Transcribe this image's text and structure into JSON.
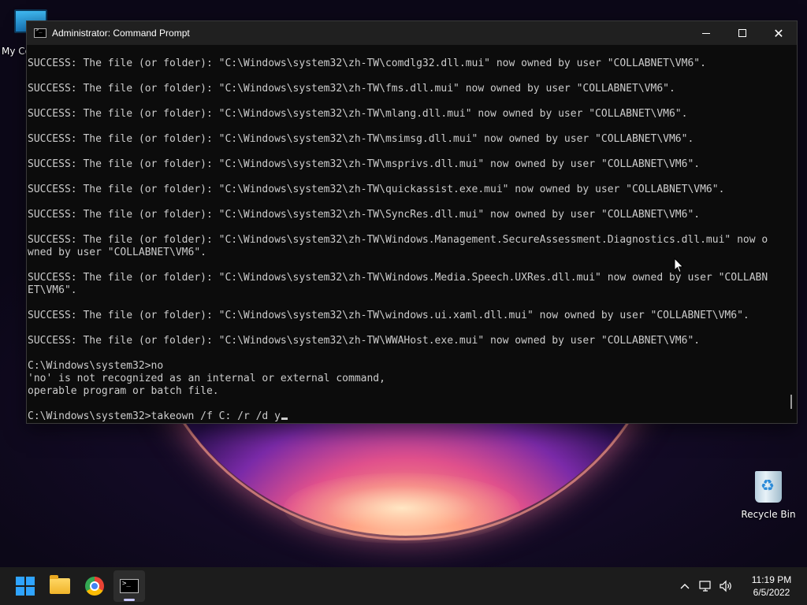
{
  "desktop": {
    "icons": [
      {
        "label": "My Co"
      },
      {
        "label": "Recycle Bin"
      }
    ]
  },
  "window": {
    "title": "Administrator: Command Prompt",
    "controls": {
      "minimize": "",
      "maximize": "",
      "close": "✕"
    }
  },
  "console": {
    "lines": [
      "SUCCESS: The file (or folder): \"C:\\Windows\\system32\\zh-TW\\comdlg32.dll.mui\" now owned by user \"COLLABNET\\VM6\".",
      "",
      "SUCCESS: The file (or folder): \"C:\\Windows\\system32\\zh-TW\\fms.dll.mui\" now owned by user \"COLLABNET\\VM6\".",
      "",
      "SUCCESS: The file (or folder): \"C:\\Windows\\system32\\zh-TW\\mlang.dll.mui\" now owned by user \"COLLABNET\\VM6\".",
      "",
      "SUCCESS: The file (or folder): \"C:\\Windows\\system32\\zh-TW\\msimsg.dll.mui\" now owned by user \"COLLABNET\\VM6\".",
      "",
      "SUCCESS: The file (or folder): \"C:\\Windows\\system32\\zh-TW\\msprivs.dll.mui\" now owned by user \"COLLABNET\\VM6\".",
      "",
      "SUCCESS: The file (or folder): \"C:\\Windows\\system32\\zh-TW\\quickassist.exe.mui\" now owned by user \"COLLABNET\\VM6\".",
      "",
      "SUCCESS: The file (or folder): \"C:\\Windows\\system32\\zh-TW\\SyncRes.dll.mui\" now owned by user \"COLLABNET\\VM6\".",
      "",
      "SUCCESS: The file (or folder): \"C:\\Windows\\system32\\zh-TW\\Windows.Management.SecureAssessment.Diagnostics.dll.mui\" now o",
      "wned by user \"COLLABNET\\VM6\".",
      "",
      "SUCCESS: The file (or folder): \"C:\\Windows\\system32\\zh-TW\\Windows.Media.Speech.UXRes.dll.mui\" now owned by user \"COLLABN",
      "ET\\VM6\".",
      "",
      "SUCCESS: The file (or folder): \"C:\\Windows\\system32\\zh-TW\\windows.ui.xaml.dll.mui\" now owned by user \"COLLABNET\\VM6\".",
      "",
      "SUCCESS: The file (or folder): \"C:\\Windows\\system32\\zh-TW\\WWAHost.exe.mui\" now owned by user \"COLLABNET\\VM6\".",
      "",
      "C:\\Windows\\system32>no",
      "'no' is not recognized as an internal or external command,",
      "operable program or batch file.",
      ""
    ],
    "prompt": "C:\\Windows\\system32>",
    "current_input": "takeown /f C: /r /d y"
  },
  "taskbar": {
    "apps": [
      {
        "name": "start-icon"
      },
      {
        "name": "file-explorer-icon"
      },
      {
        "name": "chrome-icon"
      },
      {
        "name": "command-prompt-icon"
      }
    ],
    "tray": {
      "chevron": "^",
      "network_icon": "network-icon",
      "volume_icon": "volume-icon"
    },
    "clock": {
      "time": "11:19 PM",
      "date": "6/5/2022"
    }
  },
  "colors": {
    "console_bg": "#0c0c0c",
    "console_text": "#cccccc",
    "titlebar_bg": "#202020",
    "taskbar_bg": "#1c1c1c",
    "start_blue": "#2fa4ff"
  }
}
